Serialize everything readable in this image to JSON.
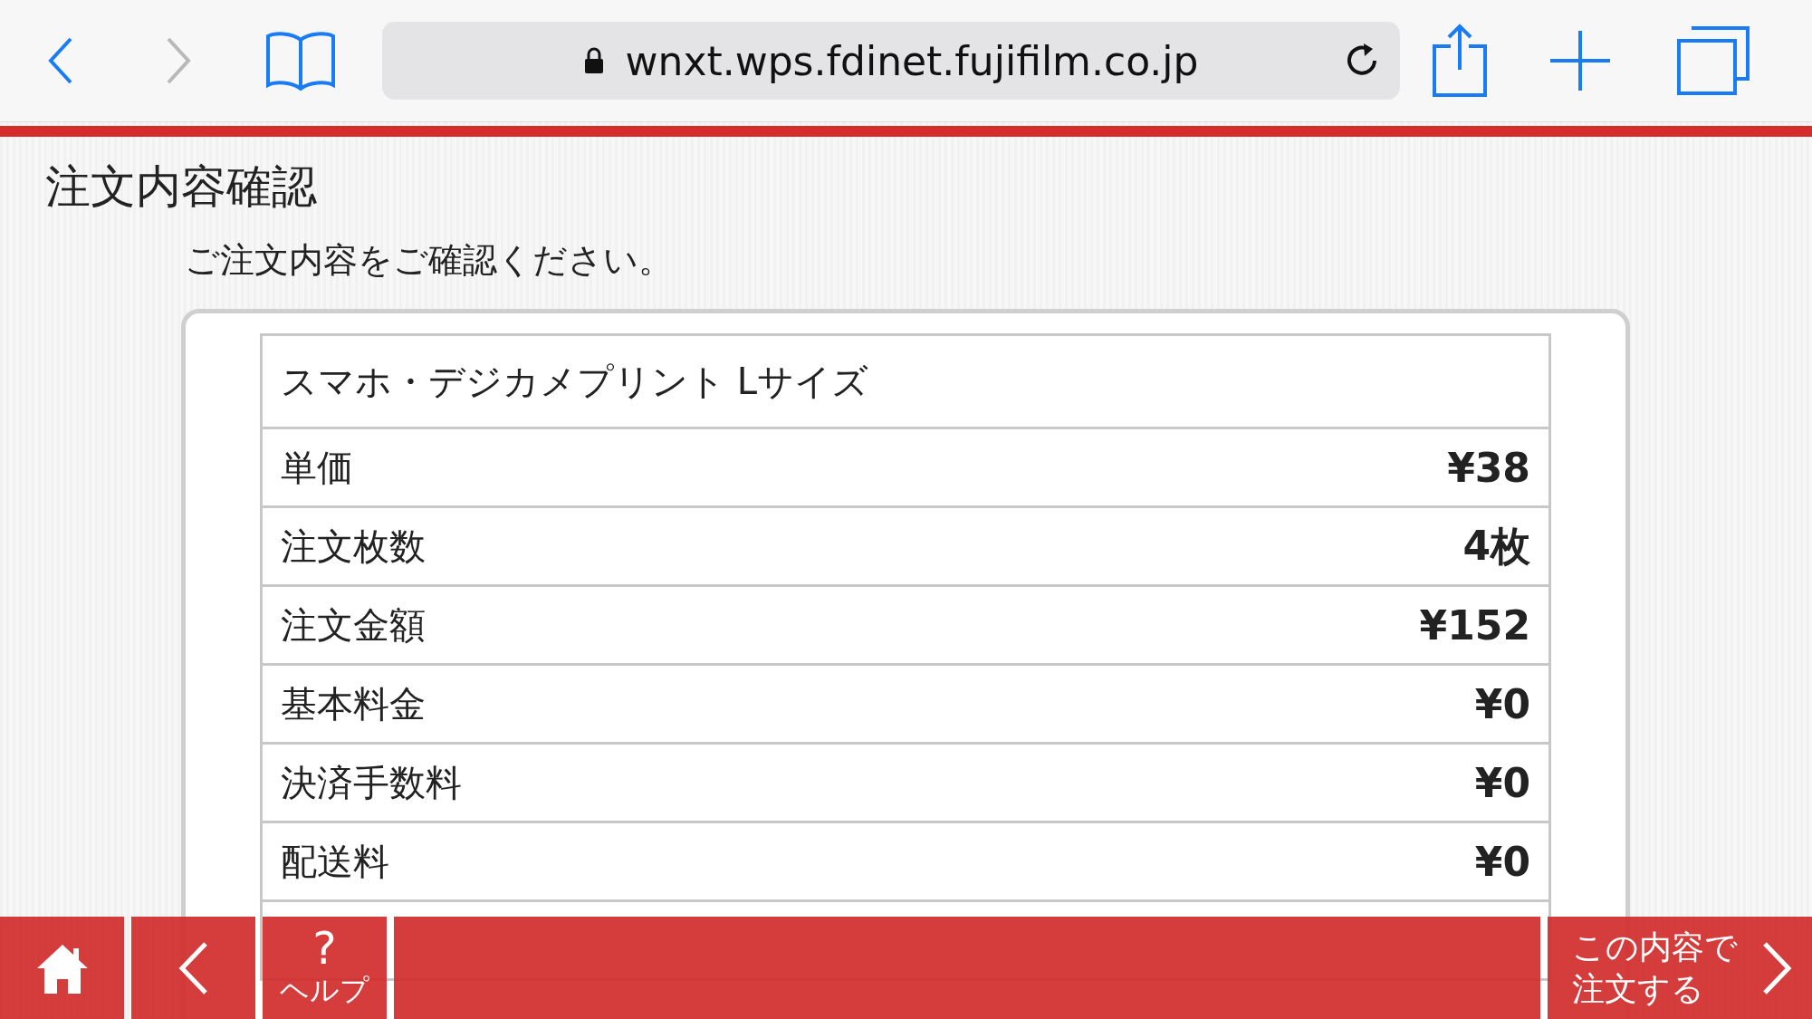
{
  "browser": {
    "url": "wnxt.wps.fdinet.fujifilm.co.jp",
    "back_enabled": true,
    "forward_enabled": false
  },
  "page": {
    "title": "注文内容確認",
    "instruction": "ご注文内容をご確認ください。"
  },
  "order": {
    "product": "スマホ・デジカメプリント Lサイズ",
    "rows": [
      {
        "label": "単価",
        "value": "¥38"
      },
      {
        "label": "注文枚数",
        "value": "4枚"
      },
      {
        "label": "注文金額",
        "value": "¥152"
      },
      {
        "label": "基本料金",
        "value": "¥0"
      },
      {
        "label": "決済手数料",
        "value": "¥0"
      },
      {
        "label": "配送料",
        "value": "¥0"
      }
    ]
  },
  "bottom_bar": [
    {
      "kind": "home"
    },
    {
      "kind": "back"
    },
    {
      "kind": "help",
      "symbol": "?",
      "label": "ヘルプ"
    },
    {
      "kind": "spacer"
    },
    {
      "kind": "next",
      "lines": [
        "この内容で",
        "注文する"
      ]
    }
  ]
}
